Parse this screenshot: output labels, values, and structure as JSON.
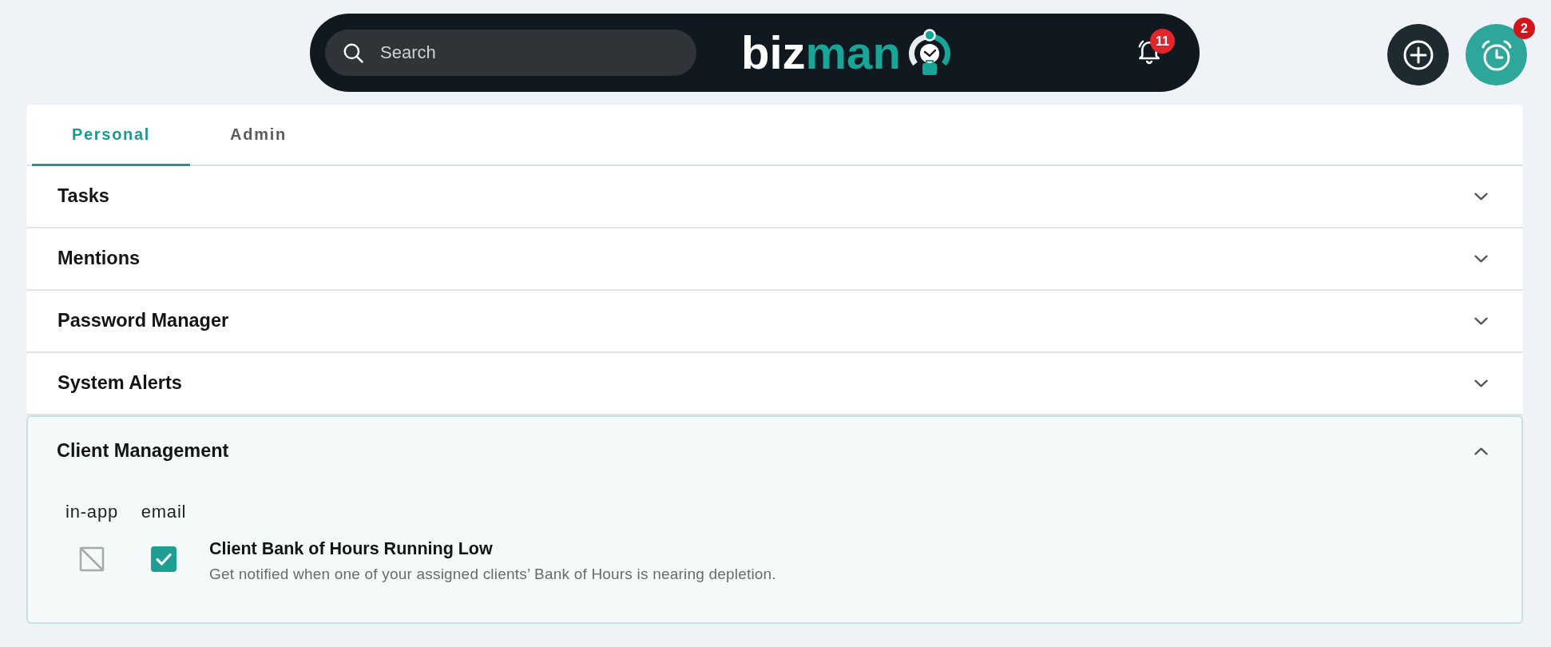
{
  "top_bar": {
    "search": {
      "placeholder": "Search"
    },
    "logo": {
      "text": "biz",
      "accent": "man"
    },
    "notifications": {
      "count": "11"
    }
  },
  "alarm": {
    "count": "2"
  },
  "tabs": [
    {
      "label": "Personal",
      "selected": true
    },
    {
      "label": "Admin",
      "selected": false
    }
  ],
  "sections": [
    {
      "title": "Tasks",
      "expanded": false
    },
    {
      "title": "Mentions",
      "expanded": false
    },
    {
      "title": "Password Manager",
      "expanded": false
    },
    {
      "title": "System Alerts",
      "expanded": false
    },
    {
      "title": "Client Management",
      "expanded": true,
      "channels": [
        "in-app",
        "email"
      ],
      "settings": [
        {
          "title": "Client Bank of Hours Running Low",
          "description": "Get notified when one of your assigned clients’ Bank of Hours is nearing depletion.",
          "options": [
            {
              "checked": false,
              "disabled": true
            },
            {
              "checked": true,
              "disabled": false
            }
          ]
        }
      ]
    }
  ]
}
